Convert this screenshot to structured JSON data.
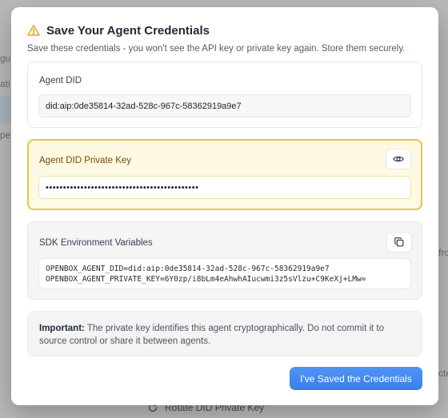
{
  "background": {
    "fragments": [
      "gur",
      "ati",
      "pe",
      "fro",
      "cte"
    ],
    "rotate_label": "Rotate DID Private Key"
  },
  "modal": {
    "title": "Save Your Agent Credentials",
    "subtitle": "Save these credentials - you won't see the API key or private key again. Store them securely.",
    "did": {
      "label": "Agent DID",
      "value": "did:aip:0de35814-32ad-528c-967c-58362919a9e7"
    },
    "private_key": {
      "label": "Agent DID Private Key",
      "masked_value": "••••••••••••••••••••••••••••••••••••••••••••"
    },
    "sdk": {
      "label": "SDK Environment Variables",
      "code": "OPENBOX_AGENT_DID=did:aip:0de35814-32ad-528c-967c-58362919a9e7\nOPENBOX_AGENT_PRIVATE_KEY=6Y0zp/i8bLm4eAhwhAIucwmi3z5sVlzu+C9KeXj+LMw="
    },
    "note": {
      "strong": "Important:",
      "text": " The private key identifies this agent cryptographically. Do not commit it to source control or share it between agents."
    },
    "confirm_label": "I've Saved the Credentials"
  },
  "colors": {
    "accent": "#3b82f6",
    "warning": "#e8c44d",
    "warning_bg": "#fef9e3",
    "warning_text": "#7a4b07"
  },
  "icons": {
    "title": "warning-triangle-icon",
    "reveal": "eye-icon",
    "copy": "copy-icon",
    "rotate": "rotate-icon"
  }
}
